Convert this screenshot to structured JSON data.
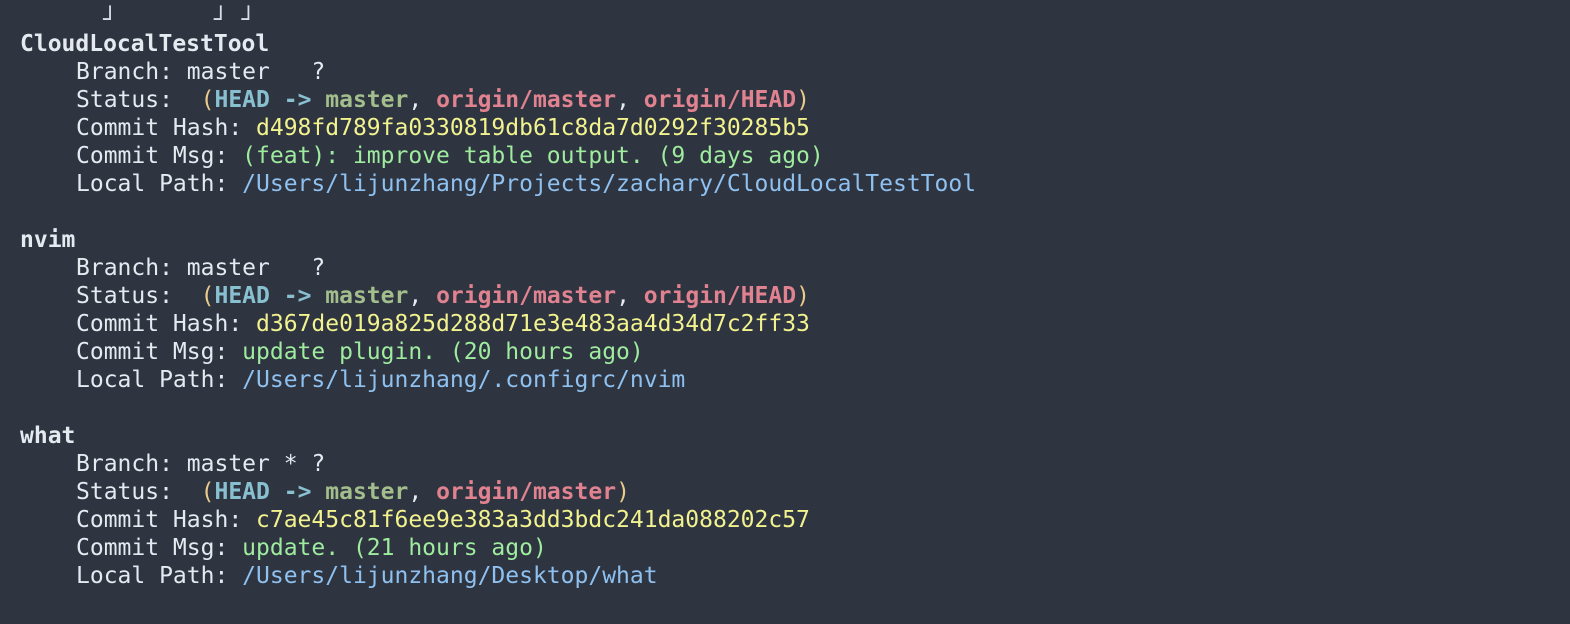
{
  "clipped_top_text": "  ┘       ┘ ┘",
  "labels": {
    "branch": "Branch: ",
    "status": "Status:  ",
    "commit_hash": "Commit Hash: ",
    "commit_msg": "Commit Msg: ",
    "local_path": "Local Path: "
  },
  "repos": [
    {
      "name": "CloudLocalTestTool",
      "branch": "master   ?",
      "status": {
        "open": "(",
        "head": "HEAD",
        "arrow": " -> ",
        "local": "master",
        "sep1": ", ",
        "remote1": "origin/master",
        "sep2": ", ",
        "remote2": "origin/HEAD",
        "close": ")"
      },
      "commit_hash": "d498fd789fa0330819db61c8da7d0292f30285b5",
      "commit_msg": "(feat): improve table output. (9 days ago)",
      "local_path": "/Users/lijunzhang/Projects/zachary/CloudLocalTestTool"
    },
    {
      "name": "nvim",
      "branch": "master   ?",
      "status": {
        "open": "(",
        "head": "HEAD",
        "arrow": " -> ",
        "local": "master",
        "sep1": ", ",
        "remote1": "origin/master",
        "sep2": ", ",
        "remote2": "origin/HEAD",
        "close": ")"
      },
      "commit_hash": "d367de019a825d288d71e3e483aa4d34d7c2ff33",
      "commit_msg": "update plugin. (20 hours ago)",
      "local_path": "/Users/lijunzhang/.configrc/nvim"
    },
    {
      "name": "what",
      "branch": "master * ?",
      "status": {
        "open": "(",
        "head": "HEAD",
        "arrow": " -> ",
        "local": "master",
        "sep1": ", ",
        "remote1": "origin/master",
        "close": ")"
      },
      "commit_hash": "c7ae45c81f6ee9e383a3dd3bdc241da088202c57",
      "commit_msg": "update. (21 hours ago)",
      "local_path": "/Users/lijunzhang/Desktop/what"
    }
  ],
  "colors": {
    "background": "#2e3440",
    "text": "#e5e9f0",
    "head": "#88c0d0",
    "local_branch": "#a3be8c",
    "remote_branch": "#e0828f",
    "paren": "#ebcb8b",
    "hash": "#f2f28e",
    "message": "#9fec9f",
    "path": "#8fc1f0"
  }
}
